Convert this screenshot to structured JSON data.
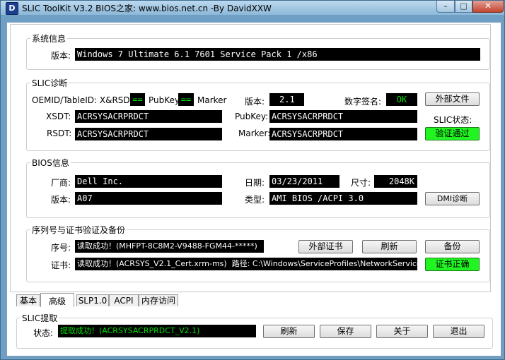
{
  "window": {
    "icon_letter": "D",
    "title": "SLIC ToolKit V3.2     BIOS之家: www.bios.net.cn   -By DavidXXW"
  },
  "system": {
    "group": "系统信息",
    "version_label": "版本:",
    "version_value": "Windows 7 Ultimate 6.1 7601 Service Pack 1 /x86"
  },
  "slic": {
    "group": "SLIC诊断",
    "oemid_label": "OEMID/TableID: X&RSDT",
    "ind1": "==",
    "pubkey_label": "PubKey",
    "ind2": "==",
    "marker_label": "Marker",
    "ver_label": "版本:",
    "ver_value": "2.1",
    "sig_label": "数字签名:",
    "sig_value": "OK",
    "external_button": "外部文件",
    "xsdt_label": "XSDT:",
    "xsdt_value": "ACRSYSACRPRDCT",
    "pubkey_field_label": "PubKey:",
    "pubkey_value": "ACRSYSACRPRDCT",
    "slic_status_label": "SLIC状态:",
    "rsdt_label": "RSDT:",
    "rsdt_value": "ACRSYSACRPRDCT",
    "marker_field_label": "Marker:",
    "marker_value": "ACRSYSACRPRDCT",
    "status_button": "验证通过"
  },
  "bios": {
    "group": "BIOS信息",
    "vendor_label": "厂商:",
    "vendor_value": "Dell Inc.",
    "date_label": "日期:",
    "date_value": "03/23/2011",
    "size_label": "尺寸:",
    "size_value": "2048K",
    "version_label": "版本:",
    "version_value": "A07",
    "type_label": "类型:",
    "type_value": "AMI BIOS /ACPI 3.0",
    "dmi_button": "DMI诊断"
  },
  "serial": {
    "group": "序列号与证书验证及备份",
    "serial_label": "序号:",
    "serial_value": "读取成功！(MHFPT-8C8M2-V9488-FGM44-*****)",
    "ext_cert_button": "外部证书",
    "refresh_button": "刷新",
    "backup_button": "备份",
    "cert_label": "证书:",
    "cert_value": "读取成功！(ACRSYS_V2.1_Cert.xrm-ms)",
    "path_label": "路径:",
    "path_value": "C:\\Windows\\ServiceProfiles\\NetworkService\\A",
    "cert_ok_button": "证书正确"
  },
  "tabs": [
    "基本",
    "高级",
    "SLP1.0",
    "ACPI",
    "内存访问"
  ],
  "extract": {
    "group": "SLIC提取",
    "status_label": "状态:",
    "status_value": "提取成功！(ACRSYSACRPRDCT_V2.1)",
    "refresh_button": "刷新",
    "save_button": "保存",
    "about_button": "关于",
    "exit_button": "退出"
  }
}
